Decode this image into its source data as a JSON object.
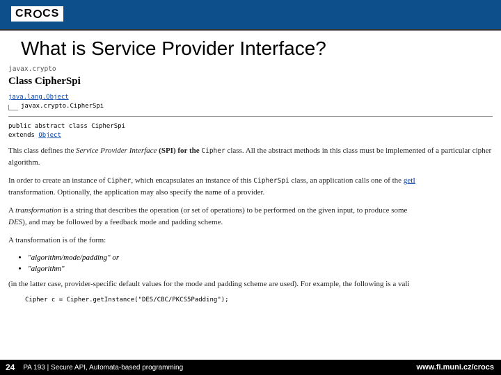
{
  "header": {
    "logo_text_left": "CR",
    "logo_text_right": "CS"
  },
  "title": "What is Service Provider Interface?",
  "javadoc": {
    "package": "javax.crypto",
    "class_label": "Class CipherSpi",
    "hierarchy": {
      "parent": "java.lang.Object",
      "child": "javax.crypto.CipherSpi"
    },
    "signature": {
      "line1": "public abstract class CipherSpi",
      "line2_prefix": "extends ",
      "line2_link": "Object"
    },
    "para1_a": "This class defines the ",
    "para1_em": "Service Provider Interface",
    "para1_b": " (SPI) for the ",
    "para1_code": "Cipher",
    "para1_c": " class. All the abstract methods in this class must be implemented of a particular cipher algorithm.",
    "para2_a": "In order to create an instance of ",
    "para2_code1": "Cipher",
    "para2_b": ", which encapsulates an instance of this ",
    "para2_code2": "CipherSpi",
    "para2_c": " class, an application calls one of the ",
    "para2_link": "getI",
    "para2_d": " transformation. Optionally, the application may also specify the name of a provider.",
    "para3_a": "A ",
    "para3_em": "transformation",
    "para3_b": " is a string that describes the operation (or set of operations) to be performed on the given input, to produce some ",
    "para3_em2": "DES",
    "para3_c": "), and may be followed by a feedback mode and padding scheme.",
    "para4": "A transformation is of the form:",
    "form1": "\"algorithm/mode/padding\" or",
    "form2": "\"algorithm\"",
    "para5": "(in the latter case, provider-specific default values for the mode and padding scheme are used). For example, the following is a vali",
    "codeblock": "Cipher c = Cipher.getInstance(\"DES/CBC/PKCS5Padding\");"
  },
  "footer": {
    "page": "24",
    "text": "PA 193 | Secure API, Automata-based programming",
    "url_prefix": "www.fi.muni.cz",
    "url_suffix": "/crocs"
  }
}
